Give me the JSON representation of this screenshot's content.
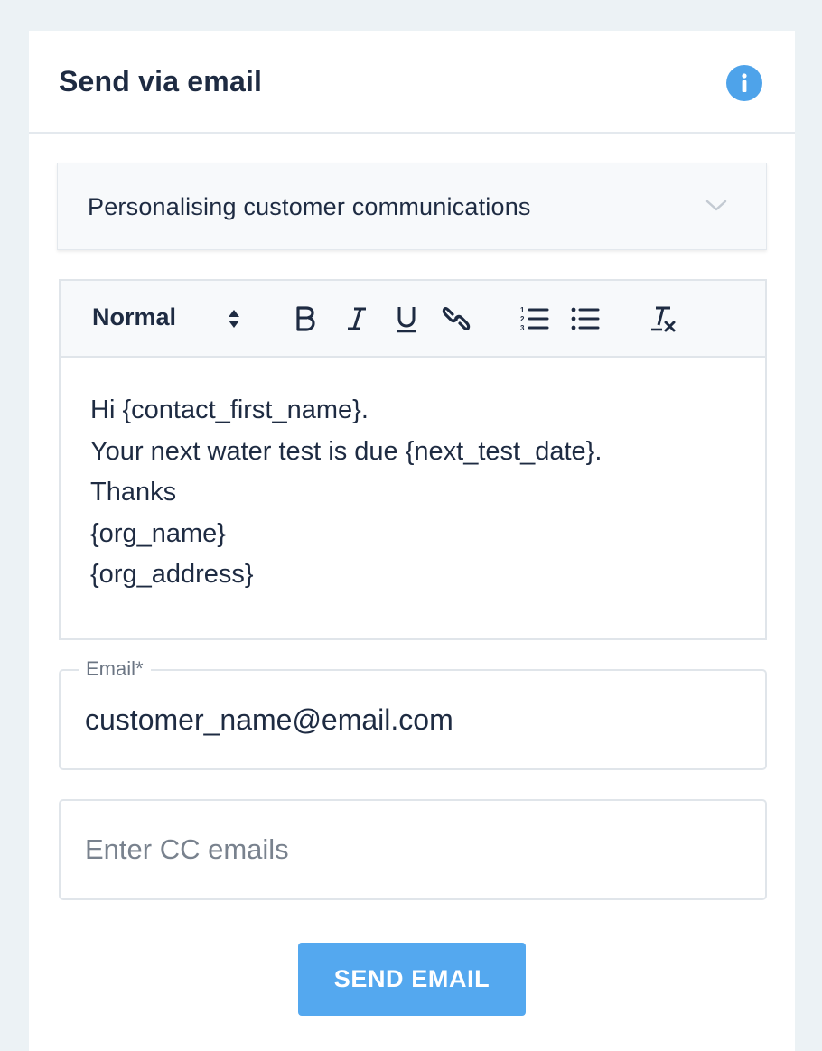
{
  "card": {
    "title": "Send via email",
    "info_icon": "info-icon"
  },
  "accordion": {
    "title": "Personalising customer communications",
    "icon": "chevron-down-icon"
  },
  "editor": {
    "toolbar": {
      "format_select": "Normal",
      "icons": [
        "select-arrows-icon",
        "bold-icon",
        "italic-icon",
        "underline-icon",
        "link-icon",
        "ordered-list-icon",
        "bullet-list-icon",
        "clear-format-icon"
      ]
    },
    "lines": [
      "Hi {contact_first_name}.",
      "Your next water test is due {next_test_date}.",
      "Thanks",
      "{org_name}",
      "{org_address}"
    ]
  },
  "email_field": {
    "label": "Email",
    "required_mark": "*",
    "value": "customer_name@email.com"
  },
  "cc_field": {
    "placeholder": "Enter CC emails"
  },
  "send_button": {
    "label": "SEND EMAIL"
  },
  "colors": {
    "page_bg": "#ecf2f5",
    "text": "#1e2b42",
    "accent": "#54a8ef",
    "info": "#4ea3ea"
  }
}
